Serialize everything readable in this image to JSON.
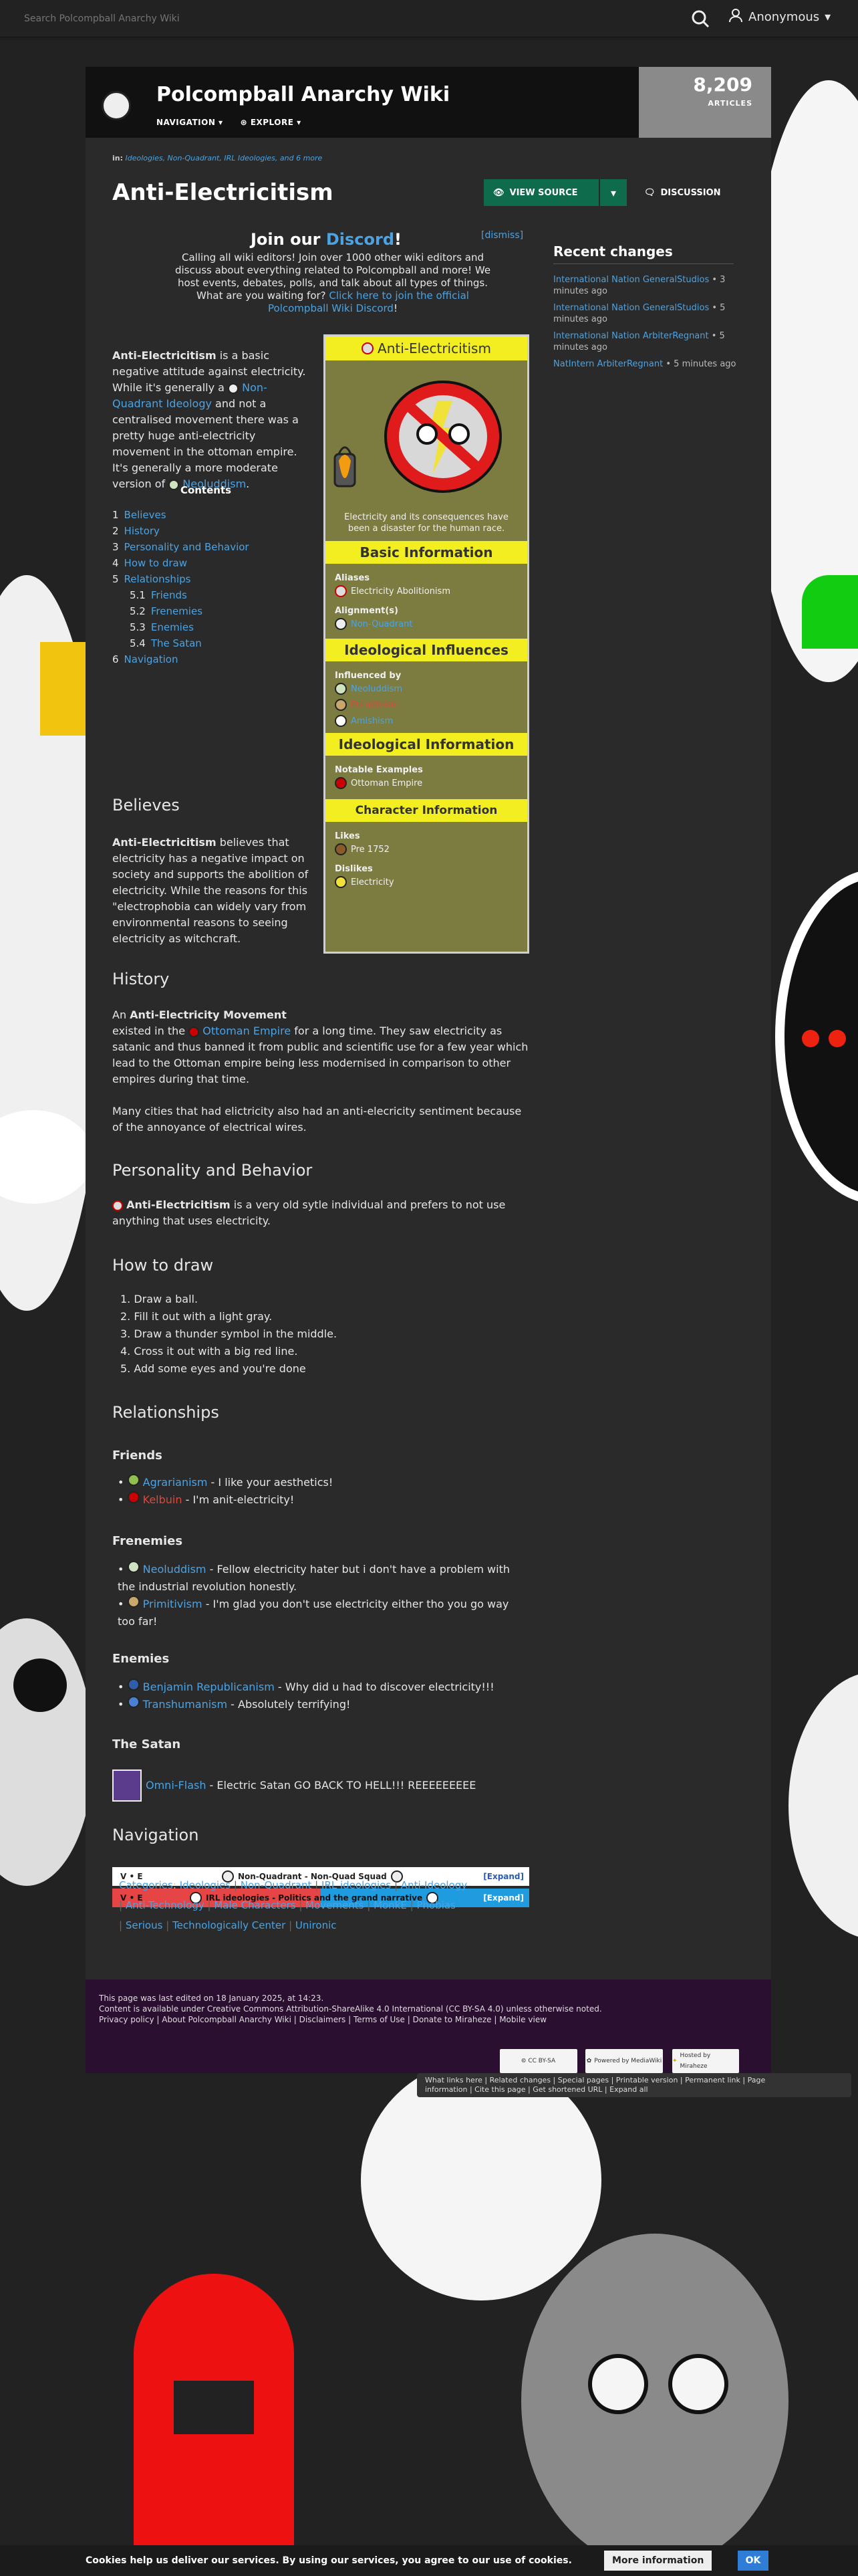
{
  "topbar": {
    "search_placeholder": "Search Polcompball Anarchy Wiki",
    "user_label": "Anonymous"
  },
  "header": {
    "site_title": "Polcompball Anarchy Wiki",
    "nav_navigation": "NAVIGATION",
    "nav_explore": "EXPLORE",
    "articles_count": "8,209",
    "articles_label": "ARTICLES"
  },
  "page": {
    "breadcrumb_in": "in:",
    "breadcrumb_links": "Ideologies, Non-Quadrant, IRL Ideologies, and 6 more",
    "title": "Anti-Electricitism",
    "view_source": "VIEW SOURCE",
    "discussion": "DISCUSSION"
  },
  "sitenotice": {
    "dismiss": "[dismiss]",
    "title_prefix": "Join our ",
    "title_link": "Discord",
    "title_suffix": "!",
    "body": "Calling all wiki editors! Join over 1000 other wiki editors and discuss about everything related to Polcompball and more! We host events, debates, polls, and talk about all types of things. What are you waiting for?",
    "body_link": "Click here to join the official Polcompball Wiki Discord",
    "body_end": "!"
  },
  "recent_changes": {
    "title": "Recent changes",
    "items": [
      {
        "link": "International Nation GeneralStudios",
        "time": " • 3 minutes ago"
      },
      {
        "link": "International Nation GeneralStudios",
        "time": " • 5 minutes ago"
      },
      {
        "link": "International Nation ArbiterRegnant",
        "time": " • 5 minutes ago"
      },
      {
        "link": "NatIntern ArbiterRegnant",
        "time": " • 5 minutes ago"
      }
    ]
  },
  "intro": {
    "bold": "Anti-Electricitism",
    "t1": " is a basic negative attitude against electricity. While it's generally a ",
    "link1": "Non-Quadrant Ideology",
    "t2": " and not a centralised movement there was a pretty huge anti-electricity movement in the ottoman empire. It's generally a more moderate version of ",
    "link2": "Neoluddism",
    "t3": "."
  },
  "toc": {
    "title": "Contents",
    "items": [
      {
        "num": "1",
        "label": "Believes"
      },
      {
        "num": "2",
        "label": "History"
      },
      {
        "num": "3",
        "label": "Personality and Behavior"
      },
      {
        "num": "4",
        "label": "How to draw"
      },
      {
        "num": "5",
        "label": "Relationships"
      },
      {
        "num": "5.1",
        "label": "Friends"
      },
      {
        "num": "5.2",
        "label": "Frenemies"
      },
      {
        "num": "5.3",
        "label": "Enemies"
      },
      {
        "num": "5.4",
        "label": "The Satan"
      },
      {
        "num": "6",
        "label": "Navigation"
      }
    ]
  },
  "infobox": {
    "title": "Anti-Electricitism",
    "caption": "Electricity and its consequences have been a disaster for the human race.",
    "sec_basic": "Basic Information",
    "aliases_label": "Aliases",
    "aliases_value": "Electricity Abolitionism",
    "alignment_label": "Alignment(s)",
    "alignment_value": "Non-Quadrant",
    "sec_influences": "Ideological Influences",
    "influenced_label": "Influenced by",
    "influenced": [
      "Neoluddism",
      "Primitivism",
      "Amishism"
    ],
    "sec_info": "Ideological Information",
    "notable_label": "Notable Examples",
    "notable_value": "Ottoman Empire",
    "sec_char": "Character Information",
    "likes_label": "Likes",
    "likes_value": "Pre 1752",
    "dislikes_label": "Dislikes",
    "dislikes_value": "Electricity"
  },
  "believes": {
    "heading": "Believes",
    "bold": "Anti-Electricitism",
    "text": " believes that electricity has a negative impact on society and supports the abolition of electricity. While the reasons for this \"electrophobia can widely vary from environmental reasons to seeing electricity as witchcraft."
  },
  "history": {
    "heading": "History",
    "t1": "An ",
    "bold": "Anti-Electricity Movement",
    "t2": " existed in the ",
    "link": "Ottoman Empire",
    "t3": " for a long time. They saw electricity as satanic and thus banned it from public and scientific use for a few year which lead to the Ottoman empire being less modernised in comparison to other empires during that time.",
    "p2": "Many cities that had elictricity also had an anti-elecricity sentiment because of the annoyance of electrical wires."
  },
  "personality": {
    "heading": "Personality and Behavior",
    "bold": "Anti-Electricitism",
    "text": " is a very old sytle individual and prefers to not use anything that uses electricity."
  },
  "how_to_draw": {
    "heading": "How to draw",
    "steps": [
      "Draw a ball.",
      "Fill it out with a light gray.",
      "Draw a thunder symbol in the middle.",
      "Cross it out with a big red line.",
      "Add some eyes and you're done"
    ]
  },
  "relationships": {
    "heading": "Relationships",
    "friends_heading": "Friends",
    "friends": [
      {
        "name": "Agrarianism",
        "text": " - I like your aesthetics!"
      },
      {
        "name": "Kelbuin",
        "text": " - I'm anit-electricity!"
      }
    ],
    "frenemies_heading": "Frenemies",
    "frenemies": [
      {
        "name": "Neoluddism",
        "text": " - Fellow electricity hater but i don't have a problem with the industrial revolution honestly."
      },
      {
        "name": "Primitivism",
        "text": " - I'm glad you don't use electricity either tho you go way too far!"
      }
    ],
    "enemies_heading": "Enemies",
    "enemies": [
      {
        "name": "Benjamin Republicanism",
        "text": " - Why did u had to discover electricity!!!"
      },
      {
        "name": "Transhumanism",
        "text": " - Absolutely terrifying!"
      }
    ],
    "satan_heading": "The Satan",
    "satan": {
      "name": "Omni-Flash",
      "text": " - Electric Satan GO BACK TO HELL!!! REEEEEEEEE"
    }
  },
  "navigation": {
    "heading": "Navigation",
    "vte": "V • E",
    "expand": "[Expand]",
    "box1": "Non-Quadrant - Non-Quad Squad",
    "box2": "IRL ideologies - Politics and the grand narrative"
  },
  "categories": {
    "label": "Categories",
    "items": [
      "Ideologies",
      "Non-Quadrant",
      "IRL ideologies",
      "Anti-Ideology",
      "Anti-Technology",
      "Male Characters",
      "Movements",
      "MonkE",
      "Phobias",
      "Serious",
      "Technologically Center",
      "Unironic"
    ]
  },
  "footer": {
    "last_edited": "This page was last edited on 18 January 2025, at 14:23.",
    "license": "Content is available under Creative Commons Attribution-ShareAlike 4.0 International (CC BY-SA 4.0) unless otherwise noted.",
    "links": "Privacy policy | About Polcompball Anarchy Wiki | Disclaimers | Terms of Use | Donate to Miraheze | Mobile view",
    "badge_cc": "CC BY-SA",
    "badge_mw": "Powered by MediaWiki",
    "badge_mh": "Hosted by Miraheze"
  },
  "tools": {
    "line1": "What links here | Related changes | Special pages | Printable version | Permanent link | Page",
    "line2": "information | Cite this page | Get shortened URL | Expand all"
  },
  "cookie": {
    "text": "Cookies help us deliver our services. By using our services, you agree to our use of cookies.",
    "more": "More information",
    "ok": "OK"
  },
  "colors": {
    "accent": "#0e6b4c",
    "link": "#4ba3e3",
    "infobox_header": "#f2ee20",
    "infobox_bg": "#7c7c40",
    "footer_bg": "#2b0f31"
  }
}
